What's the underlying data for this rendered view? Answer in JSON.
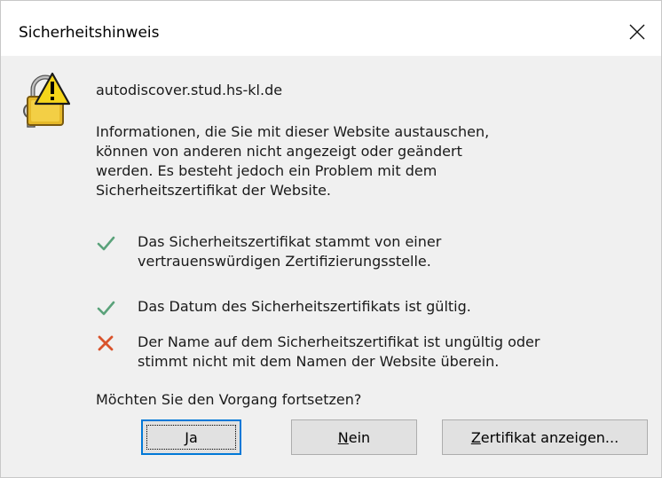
{
  "window": {
    "title": "Sicherheitshinweis"
  },
  "icons": {
    "warning": "lock-warning-icon",
    "close": "close-icon",
    "ok": "checkmark-icon",
    "error": "cross-icon"
  },
  "colors": {
    "check": "#5aa27a",
    "cross": "#d9532c",
    "warning_yellow": "#f5d51a",
    "accent": "#0078d7"
  },
  "message": {
    "host": "autodiscover.stud.hs-kl.de",
    "description": "Informationen, die Sie mit dieser Website austauschen,\nkönnen von anderen nicht angezeigt oder geändert\nwerden. Es besteht jedoch ein Problem mit dem\nSicherheitszertifikat der Website.",
    "checks": [
      {
        "status": "ok",
        "text": "Das Sicherheitszertifikat stammt von einer\nvertrauenswürdigen Zertifizierungsstelle."
      },
      {
        "status": "ok",
        "text": "Das Datum des Sicherheitszertifikats ist gültig."
      },
      {
        "status": "error",
        "text": "Der Name auf dem Sicherheitszertifikat ist ungültig oder\nstimmt nicht mit dem Namen der Website überein."
      }
    ],
    "question": "Möchten Sie den Vorgang fortsetzen?"
  },
  "buttons": {
    "yes": {
      "mnemonic": "J",
      "rest": "a"
    },
    "no": {
      "mnemonic": "N",
      "rest": "ein"
    },
    "view_cert": {
      "mnemonic": "Z",
      "rest": "ertifikat anzeigen..."
    }
  }
}
